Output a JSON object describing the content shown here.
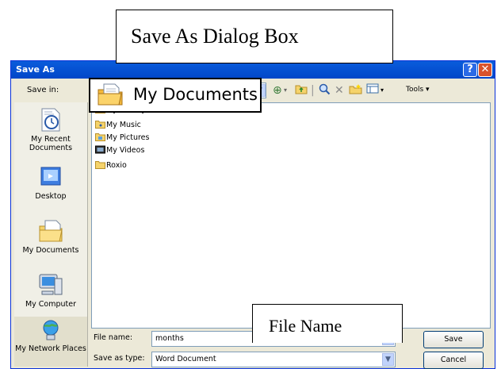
{
  "callouts": {
    "top": "Save As Dialog Box",
    "mydocs": "My Documents",
    "filename": "File Name"
  },
  "dialog": {
    "title": "Save As",
    "help_glyph": "?",
    "close_glyph": "✕",
    "save_in_label": "Save in:",
    "save_in_value": "My Documents",
    "toolbar": {
      "tools_label": "Tools ▾"
    },
    "places": [
      {
        "label": "My Recent Documents",
        "icon": "recent-documents-icon"
      },
      {
        "label": "Desktop",
        "icon": "desktop-icon"
      },
      {
        "label": "My Documents",
        "icon": "my-documents-icon"
      },
      {
        "label": "My Computer",
        "icon": "my-computer-icon"
      },
      {
        "label": "My Network Places",
        "icon": "network-places-icon"
      }
    ],
    "files": [
      "My Library",
      "My Music",
      "My Pictures",
      "My Videos",
      "Roxio"
    ],
    "file_name_label": "File name:",
    "file_name_value": "months",
    "save_type_label": "Save as type:",
    "save_type_value": "Word Document",
    "save_button": "Save",
    "cancel_button": "Cancel"
  },
  "colors": {
    "titlebar": "#0a5ddb",
    "dialog_bg": "#ece9d8",
    "close_button": "#d9532c",
    "field_border": "#7f9db9"
  }
}
